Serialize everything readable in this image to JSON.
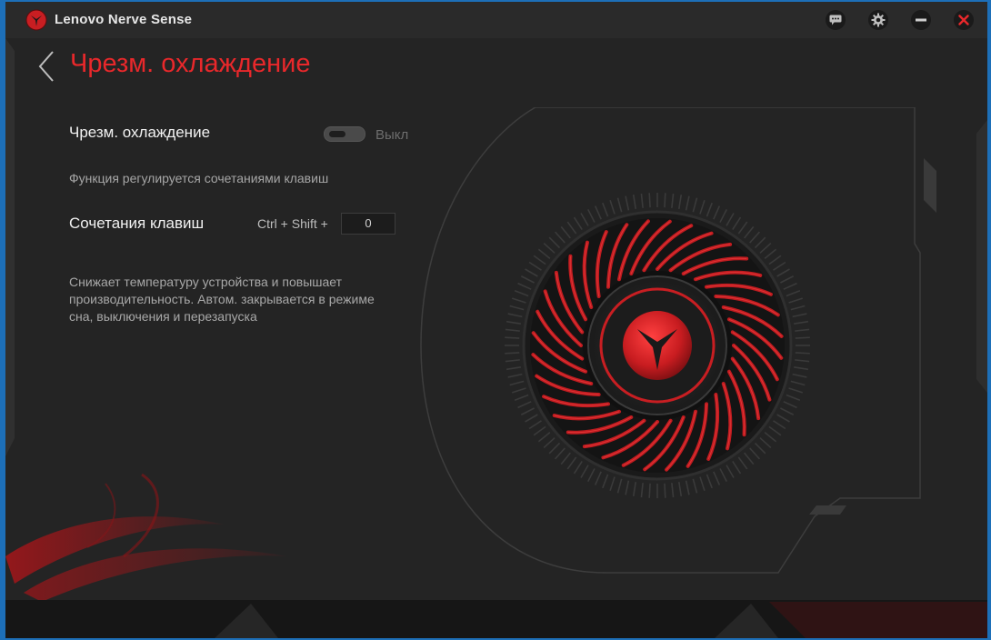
{
  "window": {
    "app_title": "Lenovo Nerve Sense",
    "titlebar_buttons": [
      "chat-icon",
      "gear-icon",
      "minimize-icon",
      "close-icon"
    ]
  },
  "page": {
    "title": "Чрезм. охлаждение"
  },
  "settings": {
    "toggle_label": "Чрезм. охлаждение",
    "toggle_state": "Выкл",
    "hint": "Функция регулируется сочетаниями клавиш",
    "hotkey_label": "Сочетания клавиш",
    "hotkey_combo": "Ctrl + Shift +",
    "hotkey_key": "0",
    "description": "Снижает температуру устройства и повышает производительность. Автом. закрывается в режиме сна, выключения и перезапуска"
  },
  "colors": {
    "accent": "#e8282b",
    "background": "#242424",
    "desktop": "#1d6fb8"
  }
}
